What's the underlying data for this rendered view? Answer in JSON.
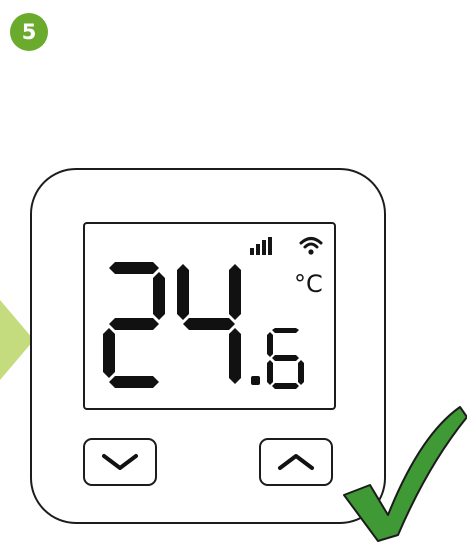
{
  "step": {
    "number": "5"
  },
  "display": {
    "temperature_integer": "24",
    "temperature_decimal": "6",
    "unit": "°C",
    "icons": [
      "signal-strength-icon",
      "wifi-icon"
    ]
  },
  "buttons": [
    {
      "name": "down-button",
      "icon": "chevron-down-icon"
    },
    {
      "name": "up-button",
      "icon": "chevron-up-icon"
    }
  ],
  "colors": {
    "badge": "#6aab2e",
    "arrow": "#c5dc7e",
    "check": "#3f9a35",
    "outline": "#1c1c1c"
  }
}
